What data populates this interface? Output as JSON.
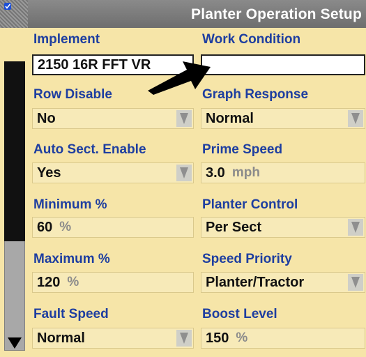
{
  "window": {
    "title": "Planter Operation Setup"
  },
  "fields": {
    "implement": {
      "label": "Implement",
      "value": "2150 16R FFT VR"
    },
    "work_condition": {
      "label": "Work Condition",
      "value": ""
    },
    "row_disable": {
      "label": "Row Disable",
      "value": "No"
    },
    "graph_response": {
      "label": "Graph Response",
      "value": "Normal"
    },
    "auto_sect_enable": {
      "label": "Auto Sect. Enable",
      "value": "Yes"
    },
    "prime_speed": {
      "label": "Prime Speed",
      "value": "3.0",
      "unit": "mph"
    },
    "minimum_pct": {
      "label": "Minimum %",
      "value": "60",
      "unit": "%"
    },
    "planter_control": {
      "label": "Planter Control",
      "value": "Per Sect"
    },
    "maximum_pct": {
      "label": "Maximum %",
      "value": "120",
      "unit": "%"
    },
    "speed_priority": {
      "label": "Speed Priority",
      "value": "Planter/Tractor"
    },
    "fault_speed": {
      "label": "Fault Speed",
      "value": "Normal"
    },
    "boost_level": {
      "label": "Boost Level",
      "value": "150",
      "unit": "%"
    }
  },
  "icons": {
    "window_icon": "checkbox-icon",
    "dropdown": "triangle-down-icon",
    "scroll_down": "arrow-down-icon",
    "pointer": "pointer-arrow-icon"
  },
  "colors": {
    "background": "#f6e5a8",
    "label": "#1e3ea0",
    "titlebar": "#7c7c7c"
  }
}
